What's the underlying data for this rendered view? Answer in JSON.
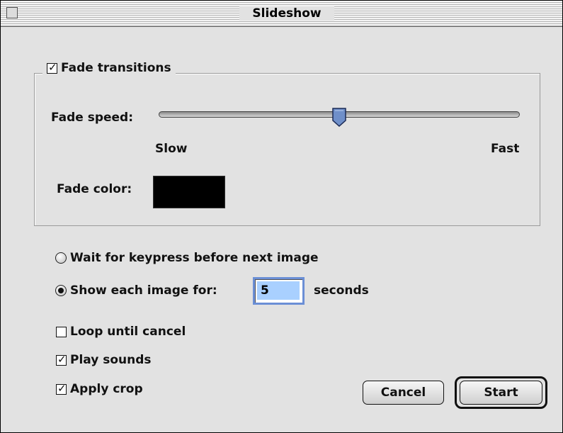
{
  "window": {
    "title": "Slideshow"
  },
  "fade": {
    "transitions_label": "Fade transitions",
    "transitions_checked": true,
    "speed_label": "Fade speed:",
    "speed_min_label": "Slow",
    "speed_max_label": "Fast",
    "speed_value": 0.5,
    "color_label": "Fade color:",
    "color_value": "#000000"
  },
  "advance": {
    "wait_label": "Wait for keypress before next image",
    "wait_selected": false,
    "timed_label": "Show each image for:",
    "timed_selected": true,
    "seconds_value": "5",
    "seconds_unit": "seconds"
  },
  "options": {
    "loop_label": "Loop until cancel",
    "loop_checked": false,
    "sounds_label": "Play sounds",
    "sounds_checked": true,
    "crop_label": "Apply crop",
    "crop_checked": true
  },
  "buttons": {
    "cancel": "Cancel",
    "start": "Start"
  },
  "icons": {
    "checkbox_checked": "checkmark-icon",
    "slider_thumb": "slider-thumb-icon"
  }
}
